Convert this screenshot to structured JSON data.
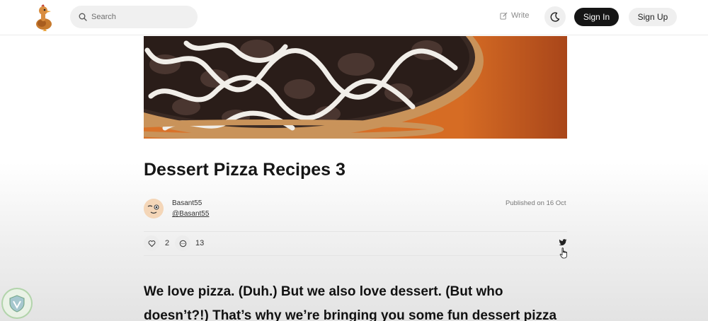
{
  "header": {
    "search_placeholder": "Search",
    "write_label": "Write",
    "signin_label": "Sign In",
    "signup_label": "Sign Up"
  },
  "article": {
    "title": "Dessert Pizza Recipes 3",
    "author_name": "Basant55",
    "author_handle": "@Basant55",
    "published": "Published on 16 Oct",
    "likes": "2",
    "comments": "13",
    "body": "We love pizza. (Duh.) But we also love dessert. (But who doesn’t?!) That’s why we’re bringing you some fun dessert pizza"
  },
  "colors": {
    "signin_bg": "#151515",
    "hero_orange": "#d46a22"
  }
}
